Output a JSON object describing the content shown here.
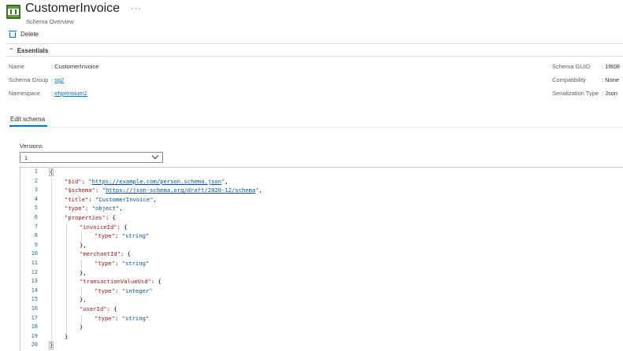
{
  "header": {
    "title": "CustomerInvoice",
    "subtitle": "Schema Overview",
    "more": "···"
  },
  "toolbar": {
    "delete_label": "Delete"
  },
  "essentials": {
    "label": "Essentials",
    "left": [
      {
        "key": "Name",
        "value": ": CustomerInvoice",
        "is_link": false
      },
      {
        "key": "Schema Group",
        "value": "sg2",
        "is_link": true
      },
      {
        "key": "Namespace",
        "value": "ehpremium2",
        "is_link": true
      }
    ],
    "right": [
      {
        "key": "Schema GUID",
        "value": ": 1f608"
      },
      {
        "key": "Compatibility",
        "value": ": None"
      },
      {
        "key": "Serialization Type",
        "value": ": Json"
      }
    ]
  },
  "tabs": {
    "edit_schema": "Edit schema"
  },
  "versions": {
    "label": "Versions",
    "selected": "1"
  },
  "editor": {
    "line_numbers": [
      "1",
      "2",
      "3",
      "4",
      "5",
      "6",
      "7",
      "8",
      "9",
      "10",
      "11",
      "12",
      "13",
      "14",
      "15",
      "16",
      "17",
      "18",
      "19",
      "20"
    ],
    "lines": [
      {
        "indent": 0,
        "tokens": [
          {
            "t": "punc",
            "v": "{"
          }
        ]
      },
      {
        "indent": 1,
        "tokens": [
          {
            "t": "key",
            "v": "\"$id\""
          },
          {
            "t": "punc",
            "v": ": "
          },
          {
            "t": "str",
            "v": "\""
          },
          {
            "t": "url",
            "v": "https://example.com/person.schema.json"
          },
          {
            "t": "str",
            "v": "\""
          },
          {
            "t": "punc",
            "v": ","
          }
        ]
      },
      {
        "indent": 1,
        "tokens": [
          {
            "t": "key",
            "v": "\"$schema\""
          },
          {
            "t": "punc",
            "v": ": "
          },
          {
            "t": "str",
            "v": "\""
          },
          {
            "t": "url",
            "v": "https://json-schema.org/draft/2020-12/schema"
          },
          {
            "t": "str",
            "v": "\""
          },
          {
            "t": "punc",
            "v": ","
          }
        ]
      },
      {
        "indent": 1,
        "tokens": [
          {
            "t": "key",
            "v": "\"title\""
          },
          {
            "t": "punc",
            "v": ": "
          },
          {
            "t": "str",
            "v": "\"CustomerInvoice\""
          },
          {
            "t": "punc",
            "v": ","
          }
        ]
      },
      {
        "indent": 1,
        "tokens": [
          {
            "t": "key",
            "v": "\"type\""
          },
          {
            "t": "punc",
            "v": ": "
          },
          {
            "t": "str",
            "v": "\"object\""
          },
          {
            "t": "punc",
            "v": ","
          }
        ]
      },
      {
        "indent": 1,
        "tokens": [
          {
            "t": "key",
            "v": "\"properties\""
          },
          {
            "t": "punc",
            "v": ": {"
          }
        ]
      },
      {
        "indent": 2,
        "tokens": [
          {
            "t": "key",
            "v": "\"invoiceId\""
          },
          {
            "t": "punc",
            "v": ": {"
          }
        ]
      },
      {
        "indent": 3,
        "tokens": [
          {
            "t": "key",
            "v": "\"type\""
          },
          {
            "t": "punc",
            "v": ": "
          },
          {
            "t": "str",
            "v": "\"string\""
          }
        ]
      },
      {
        "indent": 2,
        "tokens": [
          {
            "t": "punc",
            "v": "},"
          }
        ]
      },
      {
        "indent": 2,
        "tokens": [
          {
            "t": "key",
            "v": "\"merchantId\""
          },
          {
            "t": "punc",
            "v": ": {"
          }
        ]
      },
      {
        "indent": 3,
        "tokens": [
          {
            "t": "key",
            "v": "\"type\""
          },
          {
            "t": "punc",
            "v": ": "
          },
          {
            "t": "str",
            "v": "\"string\""
          }
        ]
      },
      {
        "indent": 2,
        "tokens": [
          {
            "t": "punc",
            "v": "},"
          }
        ]
      },
      {
        "indent": 2,
        "tokens": [
          {
            "t": "key",
            "v": "\"transactionValueUsd\""
          },
          {
            "t": "punc",
            "v": ": {"
          }
        ]
      },
      {
        "indent": 3,
        "tokens": [
          {
            "t": "key",
            "v": "\"type\""
          },
          {
            "t": "punc",
            "v": ": "
          },
          {
            "t": "str",
            "v": "\"integer\""
          }
        ]
      },
      {
        "indent": 2,
        "tokens": [
          {
            "t": "punc",
            "v": "},"
          }
        ]
      },
      {
        "indent": 2,
        "tokens": [
          {
            "t": "key",
            "v": "\"userId\""
          },
          {
            "t": "punc",
            "v": ": {"
          }
        ]
      },
      {
        "indent": 3,
        "tokens": [
          {
            "t": "key",
            "v": "\"type\""
          },
          {
            "t": "punc",
            "v": ": "
          },
          {
            "t": "str",
            "v": "\"string\""
          }
        ]
      },
      {
        "indent": 2,
        "tokens": [
          {
            "t": "punc",
            "v": "}"
          }
        ]
      },
      {
        "indent": 1,
        "tokens": [
          {
            "t": "punc",
            "v": "}"
          }
        ]
      },
      {
        "indent": 0,
        "tokens": [
          {
            "t": "punc",
            "v": "}"
          }
        ]
      }
    ]
  },
  "icons": {
    "resource": "schema-icon",
    "delete": "trash-icon",
    "collapse": "chevron-up-icon",
    "dropdown": "chevron-down-icon"
  },
  "colors": {
    "accent": "#0078d4",
    "json_key": "#a31515",
    "json_string": "#0451a5",
    "line_number": "#237893"
  }
}
